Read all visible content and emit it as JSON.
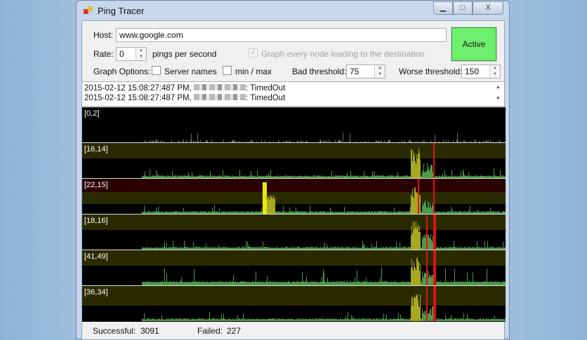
{
  "window": {
    "title": "Ping Tracer",
    "minimize": "▁",
    "maximize": "□",
    "close": "X"
  },
  "form": {
    "host_label": "Host:",
    "host_value": "www.google.com",
    "rate_label": "Rate:",
    "rate_value": "0",
    "rate_unit": "pings per second",
    "graph_every_node": "Graph every node leading to the destination",
    "graph_every_node_checked": true,
    "graph_options_label": "Graph Options:",
    "server_names": "Server names",
    "min_max": "min / max",
    "bad_threshold_label": "Bad threshold:",
    "bad_threshold_value": "75",
    "worse_threshold_label": "Worse threshold:",
    "worse_threshold_value": "150",
    "active_button": "Active"
  },
  "log": [
    {
      "time": "2015-02-12 15:08:27:487 PM,",
      "result": ": TimedOut"
    },
    {
      "time": "2015-02-12 15:08:27:487 PM,",
      "result": ": TimedOut"
    }
  ],
  "graphs": [
    {
      "label": "[0,2]"
    },
    {
      "label": "[16,14]"
    },
    {
      "label": "[22,15]"
    },
    {
      "label": "[18,16]"
    },
    {
      "label": "[41,49]"
    },
    {
      "label": "[36,34]"
    }
  ],
  "colors": {
    "good": "#4e9a4a",
    "bad": "#a8a820",
    "worse": "#e01010",
    "bad_band": "#2a2a00",
    "worse_band": "#2a0000",
    "active": "#6ef06e"
  },
  "status": {
    "successful_label": "Successful:",
    "successful_value": "3091",
    "failed_label": "Failed:",
    "failed_value": "227"
  }
}
